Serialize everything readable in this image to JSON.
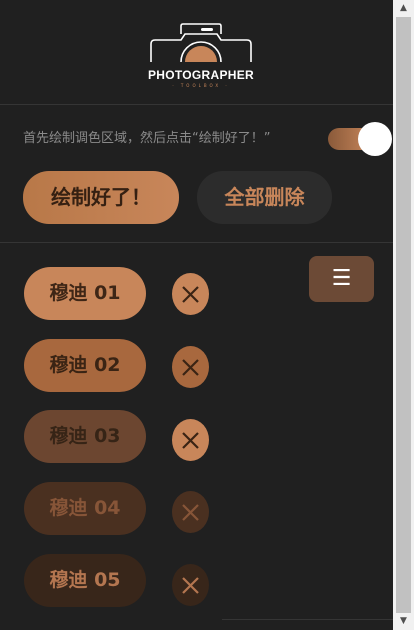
{
  "header": {
    "logo_title": "PHOTOGRAPHER",
    "logo_subtitle": "· TOOLBOX ·"
  },
  "controls": {
    "hint": "首先绘制调色区域，然后点击“绘制好了！”",
    "toggle_on": true,
    "draw_done_label": "绘制好了！",
    "delete_all_label": "全部删除",
    "menu_icon": "☰"
  },
  "regions": [
    {
      "label": "穆迪 01",
      "bg": "#c8865a",
      "text": "#3e2616",
      "xbg": "#c8865a",
      "xstroke": "#3a2414"
    },
    {
      "label": "穆迪 02",
      "bg": "#a8683e",
      "text": "#3a2414",
      "xbg": "#a8683e",
      "xstroke": "#3a2414"
    },
    {
      "label": "穆迪 03",
      "bg": "#6c4630",
      "text": "#362416",
      "xbg": "#c8865a",
      "xstroke": "#3a2414"
    },
    {
      "label": "穆迪 04",
      "bg": "#4a3020",
      "text": "#875538",
      "xbg": "#4a3020",
      "xstroke": "#875538"
    },
    {
      "label": "穆迪 05",
      "bg": "#38261a",
      "text": "#b47650",
      "xbg": "#38261a",
      "xstroke": "#b47650"
    }
  ],
  "scrollbar": {
    "up_arrow": "▲",
    "down_arrow": "▼"
  },
  "colors": {
    "accent": "#c8865a",
    "background": "#202020"
  }
}
